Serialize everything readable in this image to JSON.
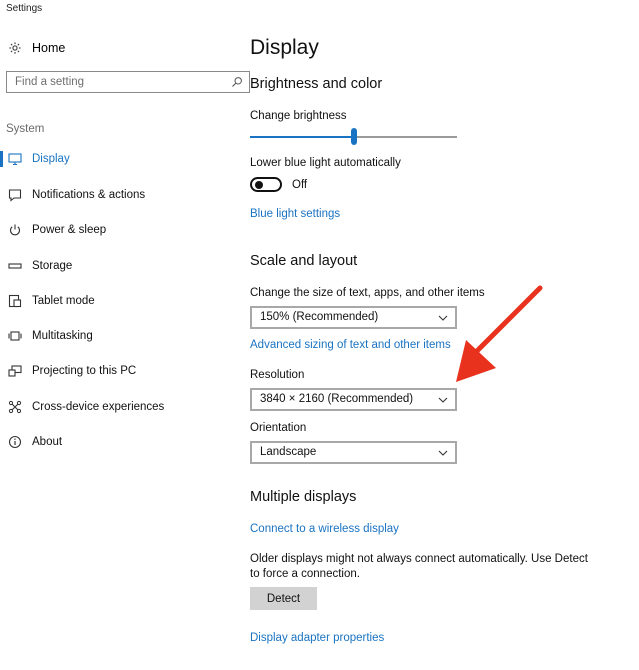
{
  "window": {
    "title": "Settings"
  },
  "sidebar": {
    "home_label": "Home",
    "search_placeholder": "Find a setting",
    "section_label": "System",
    "items": [
      {
        "label": "Display",
        "icon": "monitor-icon",
        "active": true
      },
      {
        "label": "Notifications & actions",
        "icon": "notifications-icon"
      },
      {
        "label": "Power & sleep",
        "icon": "power-icon"
      },
      {
        "label": "Storage",
        "icon": "storage-icon"
      },
      {
        "label": "Tablet mode",
        "icon": "tablet-mode-icon"
      },
      {
        "label": "Multitasking",
        "icon": "multitasking-icon"
      },
      {
        "label": "Projecting to this PC",
        "icon": "projecting-icon"
      },
      {
        "label": "Cross-device experiences",
        "icon": "cross-device-icon"
      },
      {
        "label": "About",
        "icon": "info-icon"
      }
    ]
  },
  "main": {
    "title": "Display",
    "brightness": {
      "heading": "Brightness and color",
      "change_label": "Change brightness",
      "level": 0.5,
      "blue_light_label": "Lower blue light automatically",
      "toggle_state": "Off",
      "blue_light_link": "Blue light settings"
    },
    "scale": {
      "heading": "Scale and layout",
      "size_label": "Change the size of text, apps, and other items",
      "size_value": "150% (Recommended)",
      "advanced_link": "Advanced sizing of text and other items",
      "resolution_label": "Resolution",
      "resolution_value": "3840 × 2160 (Recommended)",
      "orientation_label": "Orientation",
      "orientation_value": "Landscape"
    },
    "multiple": {
      "heading": "Multiple displays",
      "wireless_link": "Connect to a wireless display",
      "description": "Older displays might not always connect automatically. Use Detect to force a connection.",
      "detect_label": "Detect",
      "adapter_link": "Display adapter properties"
    }
  },
  "colors": {
    "accent": "#1a73c2",
    "annotation_arrow": "#e8321d"
  }
}
